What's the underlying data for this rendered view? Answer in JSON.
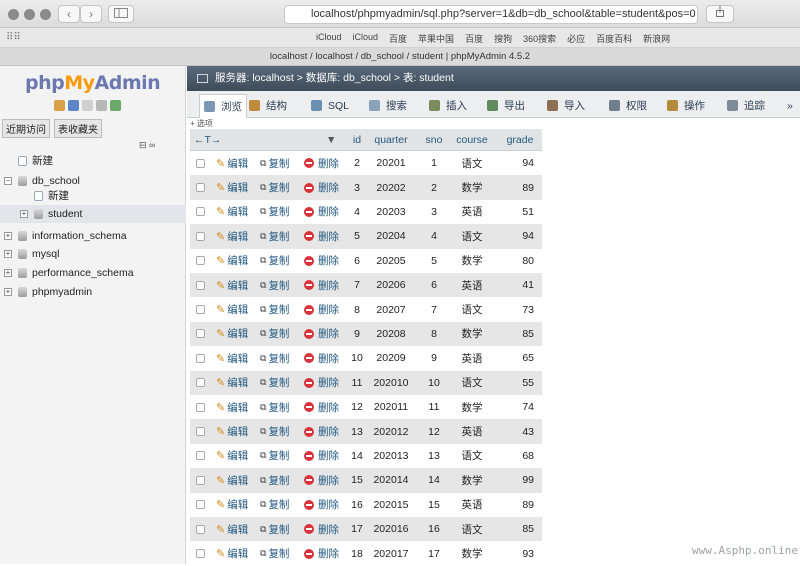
{
  "browser": {
    "url": "localhost/phpmyadmin/sql.php?server=1&db=db_school&table=student&pos=0",
    "tab_title": "localhost / localhost / db_school / student | phpMyAdmin 4.5.2",
    "back_icon": "‹",
    "forward_icon": "›",
    "bookmarks": [
      "iCloud",
      "iCloud",
      "百度",
      "苹果中国",
      "百度",
      "搜狗",
      "360搜索",
      "必应",
      "百度百科",
      "新浪网"
    ]
  },
  "logo": {
    "php": "php",
    "my": "My",
    "admin": "Admin"
  },
  "nav": {
    "tab_recent": "近期访问",
    "tab_favorites": "表收藏夹",
    "link_icon": "⊟ ∞",
    "tree": [
      {
        "label": "新建",
        "level": 0
      },
      {
        "label": "db_school",
        "level": 0
      },
      {
        "label": "新建",
        "level": 1
      },
      {
        "label": "student",
        "level": 1
      },
      {
        "label": "information_schema",
        "level": 0
      },
      {
        "label": "mysql",
        "level": 0
      },
      {
        "label": "performance_schema",
        "level": 0
      },
      {
        "label": "phpmyadmin",
        "level": 0
      }
    ]
  },
  "breadcrumb": {
    "server": "服务器: localhost",
    "database": "数据库: db_school",
    "table": "表: student"
  },
  "menu": {
    "tabs": [
      {
        "label": "浏览",
        "color": "#7a98b6"
      },
      {
        "label": "结构",
        "color": "#c08a3e"
      },
      {
        "label": "SQL",
        "color": "#6b8fb0"
      },
      {
        "label": "搜索",
        "color": "#8aa1b8"
      },
      {
        "label": "插入",
        "color": "#7c8b5e"
      },
      {
        "label": "导出",
        "color": "#5f8a5b"
      },
      {
        "label": "导入",
        "color": "#8d6f52"
      },
      {
        "label": "权限",
        "color": "#6f7d8c"
      },
      {
        "label": "操作",
        "color": "#b48a3d"
      },
      {
        "label": "追踪",
        "color": "#7d8a99"
      }
    ],
    "overflow_icon": "»"
  },
  "table": {
    "options_label": "+ 选项",
    "sort_arrows": "←T→",
    "sort_menu_icon": "▼",
    "columns": [
      "id",
      "quarter",
      "sno",
      "course",
      "grade"
    ],
    "actions": {
      "edit": "编辑",
      "copy": "复制",
      "delete": "删除"
    },
    "rows": [
      {
        "id": "2",
        "quarter": "20201",
        "sno": "1",
        "course": "语文",
        "grade": "94"
      },
      {
        "id": "3",
        "quarter": "20202",
        "sno": "2",
        "course": "数学",
        "grade": "89"
      },
      {
        "id": "4",
        "quarter": "20203",
        "sno": "3",
        "course": "英语",
        "grade": "51"
      },
      {
        "id": "5",
        "quarter": "20204",
        "sno": "4",
        "course": "语文",
        "grade": "94"
      },
      {
        "id": "6",
        "quarter": "20205",
        "sno": "5",
        "course": "数学",
        "grade": "80"
      },
      {
        "id": "7",
        "quarter": "20206",
        "sno": "6",
        "course": "英语",
        "grade": "41"
      },
      {
        "id": "8",
        "quarter": "20207",
        "sno": "7",
        "course": "语文",
        "grade": "73"
      },
      {
        "id": "9",
        "quarter": "20208",
        "sno": "8",
        "course": "数学",
        "grade": "85"
      },
      {
        "id": "10",
        "quarter": "20209",
        "sno": "9",
        "course": "英语",
        "grade": "65"
      },
      {
        "id": "11",
        "quarter": "202010",
        "sno": "10",
        "course": "语文",
        "grade": "55"
      },
      {
        "id": "12",
        "quarter": "202011",
        "sno": "11",
        "course": "数学",
        "grade": "74"
      },
      {
        "id": "13",
        "quarter": "202012",
        "sno": "12",
        "course": "英语",
        "grade": "43"
      },
      {
        "id": "14",
        "quarter": "202013",
        "sno": "13",
        "course": "语文",
        "grade": "68"
      },
      {
        "id": "15",
        "quarter": "202014",
        "sno": "14",
        "course": "数学",
        "grade": "99"
      },
      {
        "id": "16",
        "quarter": "202015",
        "sno": "15",
        "course": "英语",
        "grade": "89"
      },
      {
        "id": "17",
        "quarter": "202016",
        "sno": "16",
        "course": "语文",
        "grade": "85"
      },
      {
        "id": "18",
        "quarter": "202017",
        "sno": "17",
        "course": "数学",
        "grade": "93"
      }
    ]
  },
  "watermark": "www.Asphp.online"
}
